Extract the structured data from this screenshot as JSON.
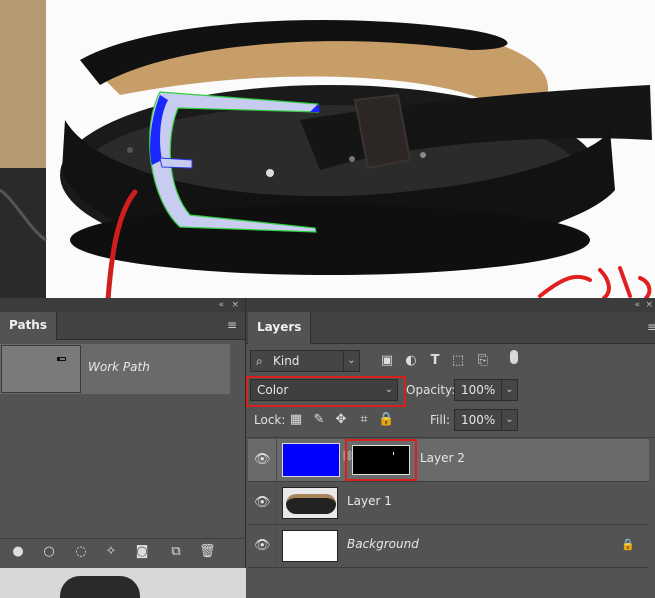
{
  "panels": {
    "collapse_glyph": "«",
    "close_glyph": "×",
    "menu_glyph": "≡"
  },
  "paths": {
    "tab": "Paths",
    "items": [
      {
        "label": "Work Path"
      }
    ],
    "bottom_icons": [
      "fill-path-icon",
      "stroke-path-icon",
      "load-selection-icon",
      "make-path-icon",
      "add-mask-icon",
      "new-path-icon",
      "delete-icon"
    ]
  },
  "layers": {
    "tab": "Layers",
    "filter": {
      "value": "Kind",
      "search_glyph": "⌕"
    },
    "filter_icons": [
      "image-filter-icon",
      "adjustment-filter-icon",
      "type-filter-icon",
      "shape-filter-icon",
      "smart-object-filter-icon",
      "filter-toggle-icon"
    ],
    "blend_mode": "Color",
    "opacity_label": "Opacity:",
    "opacity_value": "100%",
    "lock_label": "Lock:",
    "lock_icons": [
      "lock-transparent-icon",
      "lock-image-icon",
      "lock-position-icon",
      "lock-artboard-icon",
      "lock-all-icon"
    ],
    "fill_label": "Fill:",
    "fill_value": "100%",
    "rows": [
      {
        "name": "Layer 2",
        "selected": true,
        "color": "#0000ff"
      },
      {
        "name": "Layer 1",
        "selected": false
      },
      {
        "name": "Background",
        "selected": false,
        "locked": true
      }
    ]
  },
  "colors": {
    "highlight_red": "#d9201e",
    "panel_bg": "#535353",
    "selected_row": "#6a6a6a",
    "layer2_fill": "#0000ff"
  }
}
